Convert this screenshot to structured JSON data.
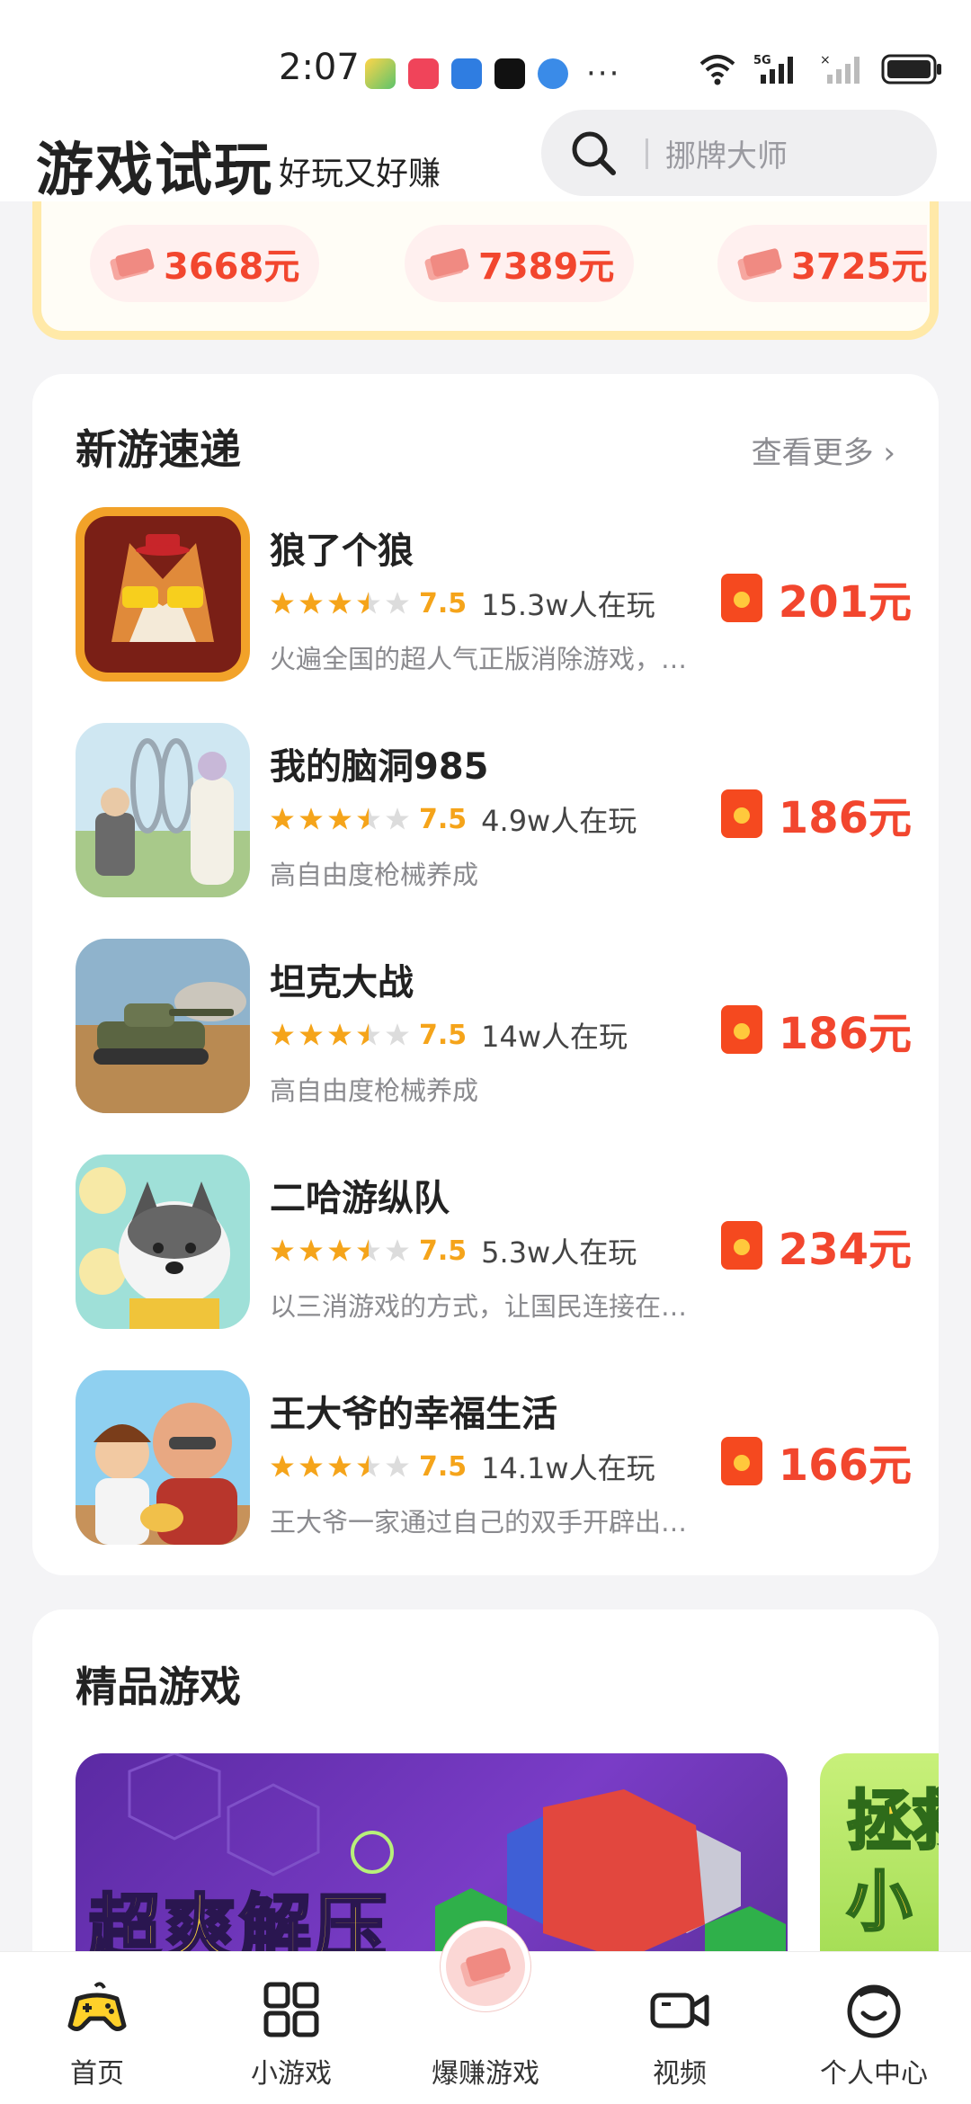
{
  "status_bar": {
    "time": "2:07",
    "dots": "···"
  },
  "header": {
    "title": "游戏试玩",
    "subtitle": "好玩又好赚",
    "search_placeholder": "挪牌大师"
  },
  "top_rewards": [
    "3668元",
    "7389元",
    "3725元"
  ],
  "new_games": {
    "title": "新游速递",
    "more": "查看更多 ›",
    "items": [
      {
        "name": "狼了个狼",
        "rating": "7.5",
        "stars": 3.5,
        "players": "15.3w人在玩",
        "desc": "火遍全国的超人气正版消除游戏，…",
        "reward": "201元"
      },
      {
        "name": "我的脑洞985",
        "rating": "7.5",
        "stars": 3.5,
        "players": "4.9w人在玩",
        "desc": "高自由度枪械养成",
        "reward": "186元"
      },
      {
        "name": "坦克大战",
        "rating": "7.5",
        "stars": 3.5,
        "players": "14w人在玩",
        "desc": "高自由度枪械养成",
        "reward": "186元"
      },
      {
        "name": "二哈游纵队",
        "rating": "7.5",
        "stars": 3.5,
        "players": "5.3w人在玩",
        "desc": "以三消游戏的方式，让国民连接在…",
        "reward": "234元"
      },
      {
        "name": "王大爷的幸福生活",
        "rating": "7.5",
        "stars": 3.5,
        "players": "14.1w人在玩",
        "desc": "王大爷一家通过自己的双手开辟出…",
        "reward": "166元"
      }
    ]
  },
  "premium": {
    "title": "精品游戏",
    "banner_text": "超爽解压",
    "banner2_text": "拯救小"
  },
  "bottom_nav": [
    {
      "label": "首页",
      "icon": "gamepad-icon"
    },
    {
      "label": "小游戏",
      "icon": "grid-icon"
    },
    {
      "label": "爆赚游戏",
      "icon": "money-icon"
    },
    {
      "label": "视频",
      "icon": "video-camera-icon"
    },
    {
      "label": "个人中心",
      "icon": "smile-face-icon"
    }
  ],
  "colors": {
    "accent_red": "#f2462e",
    "star_yellow": "#f5a41a",
    "nav_active": "#ffd12a"
  }
}
